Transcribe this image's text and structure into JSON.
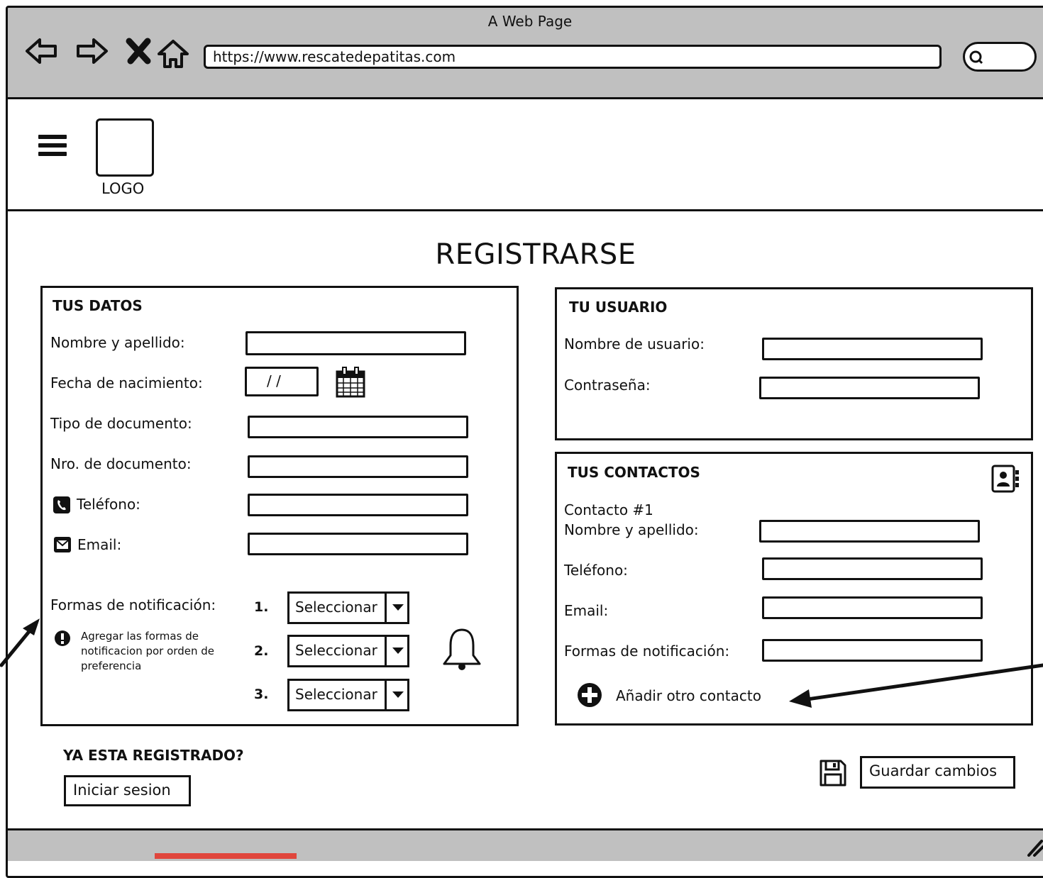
{
  "window": {
    "title": "A Web Page",
    "url": "https://www.rescatedepatitas.com"
  },
  "header": {
    "logo_label": "LOGO"
  },
  "page": {
    "title": "REGISTRARSE"
  },
  "tus_datos": {
    "title": "TUS DATOS",
    "nombre_label": "Nombre y apellido:",
    "fecha_label": "Fecha de nacimiento:",
    "fecha_value": "/ /",
    "tipo_doc_label": "Tipo de documento:",
    "nro_doc_label": "Nro. de documento:",
    "telefono_label": "Teléfono:",
    "email_label": "Email:",
    "formas_label": "Formas de notificación:",
    "hint": "Agregar las formas de notificacion por orden de preferencia",
    "selects": [
      {
        "num": "1.",
        "value": "Seleccionar"
      },
      {
        "num": "2.",
        "value": "Seleccionar"
      },
      {
        "num": "3.",
        "value": "Seleccionar"
      }
    ]
  },
  "tu_usuario": {
    "title": "TU USUARIO",
    "usuario_label": "Nombre de usuario:",
    "password_label": "Contraseña:"
  },
  "tus_contactos": {
    "title": "TUS CONTACTOS",
    "contacto_heading": "Contacto #1",
    "nombre_label": "Nombre y apellido:",
    "telefono_label": "Teléfono:",
    "email_label": "Email:",
    "formas_label": "Formas de notificación:",
    "add_label": "Añadir otro contacto"
  },
  "footer": {
    "registered_question": "YA ESTA REGISTRADO?",
    "login_button": "Iniciar sesion",
    "save_button": "Guardar cambios"
  }
}
